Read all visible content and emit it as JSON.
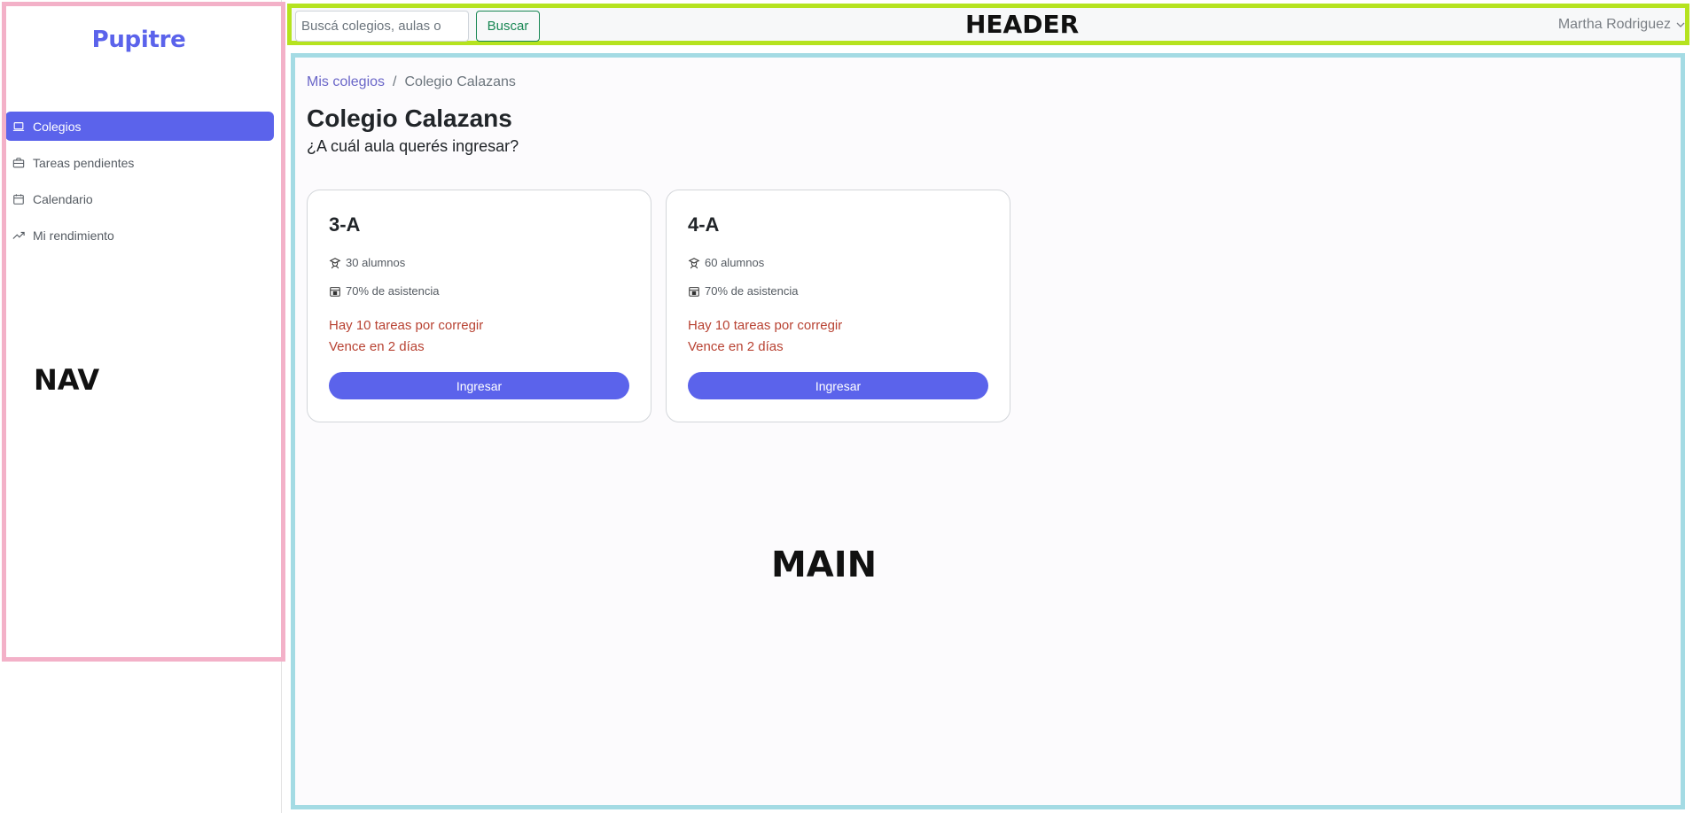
{
  "app": {
    "logo": "Pupitre"
  },
  "sidebar": {
    "annotation": "NAV",
    "items": [
      {
        "label": "Colegios",
        "icon": "laptop-icon",
        "active": true
      },
      {
        "label": "Tareas pendientes",
        "icon": "briefcase-icon",
        "active": false
      },
      {
        "label": "Calendario",
        "icon": "calendar-icon",
        "active": false
      },
      {
        "label": "Mi rendimiento",
        "icon": "trending-up-icon",
        "active": false
      }
    ]
  },
  "header": {
    "annotation": "HEADER",
    "search_placeholder": "Buscá colegios, aulas o",
    "search_value": "",
    "search_button": "Buscar",
    "user_name": "Martha Rodriguez"
  },
  "main": {
    "annotation": "MAIN",
    "breadcrumb": {
      "parent": "Mis colegios",
      "separator": "/",
      "current": "Colegio Calazans"
    },
    "title": "Colegio Calazans",
    "subtitle": "¿A cuál aula querés ingresar?",
    "classrooms": [
      {
        "name": "3-A",
        "students": "30 alumnos",
        "attendance": "70% de asistencia",
        "pending": "Hay 10 tareas por corregir",
        "due": "Vence en 2 días",
        "button": "Ingresar"
      },
      {
        "name": "4-A",
        "students": "60 alumnos",
        "attendance": "70% de asistencia",
        "pending": "Hay 10 tareas por corregir",
        "due": "Vence en 2 días",
        "button": "Ingresar"
      }
    ]
  },
  "colors": {
    "accent": "#5b63eb",
    "alert": "#b84232",
    "success": "#198754",
    "nav_frame": "#f3b1c8",
    "header_frame": "#b5e31f",
    "main_frame": "#a4dbe4"
  }
}
